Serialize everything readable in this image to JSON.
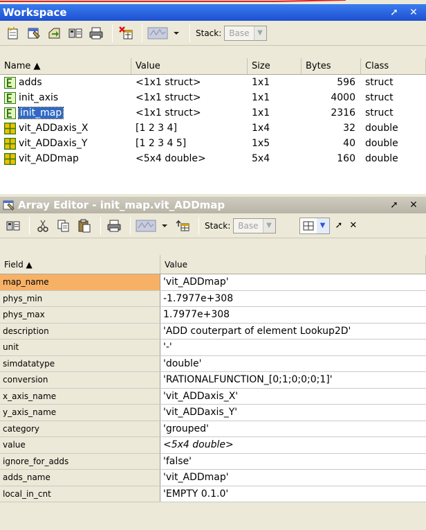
{
  "workspace": {
    "title": "Workspace",
    "stack_label": "Stack:",
    "stack_value": "Base",
    "columns": [
      "Name ▲",
      "Value",
      "Size",
      "Bytes",
      "Class"
    ],
    "variables": [
      {
        "name": "adds",
        "value": "<1x1 struct>",
        "size": "1x1",
        "bytes": "596",
        "class": "struct",
        "icon": "struct-icon"
      },
      {
        "name": "init_axis",
        "value": "<1x1 struct>",
        "size": "1x1",
        "bytes": "4000",
        "class": "struct",
        "icon": "struct-icon"
      },
      {
        "name": "init_map",
        "value": "<1x1 struct>",
        "size": "1x1",
        "bytes": "2316",
        "class": "struct",
        "icon": "struct-icon"
      },
      {
        "name": "vit_ADDaxis_X",
        "value": "[1 2 3 4]",
        "size": "1x4",
        "bytes": "32",
        "class": "double",
        "icon": "matrix-icon"
      },
      {
        "name": "vit_ADDaxis_Y",
        "value": "[1 2 3 4 5]",
        "size": "1x5",
        "bytes": "40",
        "class": "double",
        "icon": "matrix-icon"
      },
      {
        "name": "vit_ADDmap",
        "value": "<5x4 double>",
        "size": "5x4",
        "bytes": "160",
        "class": "double",
        "icon": "matrix-icon"
      }
    ]
  },
  "array_editor": {
    "title": "Array Editor - init_map.vit_ADDmap",
    "stack_label": "Stack:",
    "stack_value": "Base",
    "columns": [
      "Field ▲",
      "Value"
    ],
    "fields": [
      {
        "field": "map_name",
        "value": "'vit_ADDmap'"
      },
      {
        "field": "phys_min",
        "value": "-1.7977e+308"
      },
      {
        "field": "phys_max",
        "value": "1.7977e+308"
      },
      {
        "field": "description",
        "value": "'ADD couterpart of element Lookup2D'"
      },
      {
        "field": "unit",
        "value": "'-'"
      },
      {
        "field": "simdatatype",
        "value": "'double'"
      },
      {
        "field": "conversion",
        "value": "'RATIONALFUNCTION_[0;1;0;0;0;1]'"
      },
      {
        "field": "x_axis_name",
        "value": "'vit_ADDaxis_X'"
      },
      {
        "field": "y_axis_name",
        "value": "'vit_ADDaxis_Y'"
      },
      {
        "field": "category",
        "value": "'grouped'"
      },
      {
        "field": "value",
        "value": "<5x4 double>"
      },
      {
        "field": "ignore_for_adds",
        "value": "'false'"
      },
      {
        "field": "adds_name",
        "value": "'vit_ADDmap'"
      },
      {
        "field": "local_in_cnt",
        "value": "'EMPTY 0.1.0'"
      }
    ]
  },
  "colors": {
    "titlebar": "#2458d8",
    "selection": "#316ac5",
    "selected_field": "#f6b167"
  }
}
